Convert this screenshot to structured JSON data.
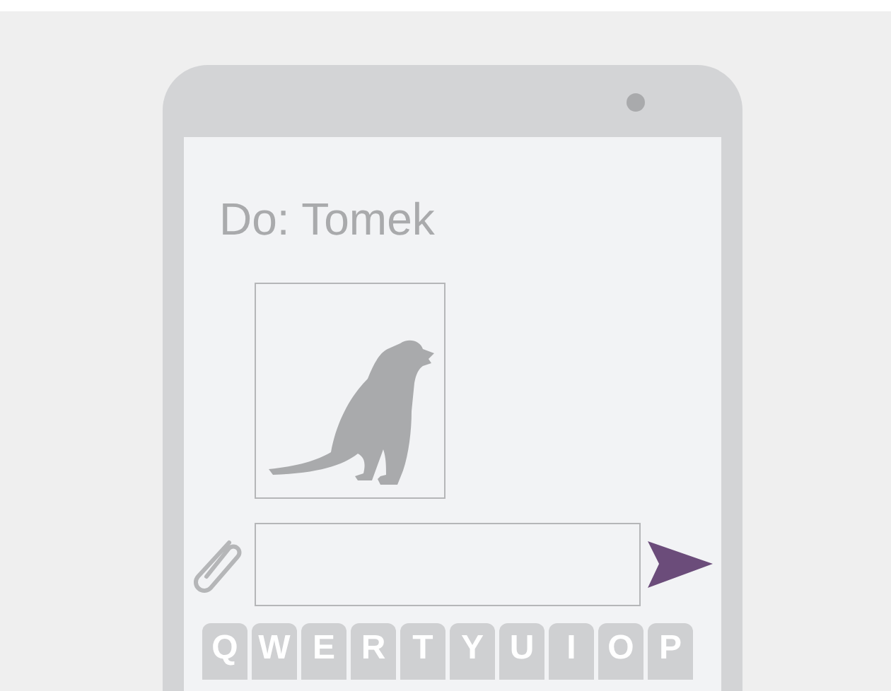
{
  "message": {
    "recipient": "Do: Tomek"
  },
  "keyboard": {
    "keys": [
      "Q",
      "W",
      "E",
      "R",
      "T",
      "Y",
      "U",
      "I",
      "O",
      "P"
    ]
  }
}
